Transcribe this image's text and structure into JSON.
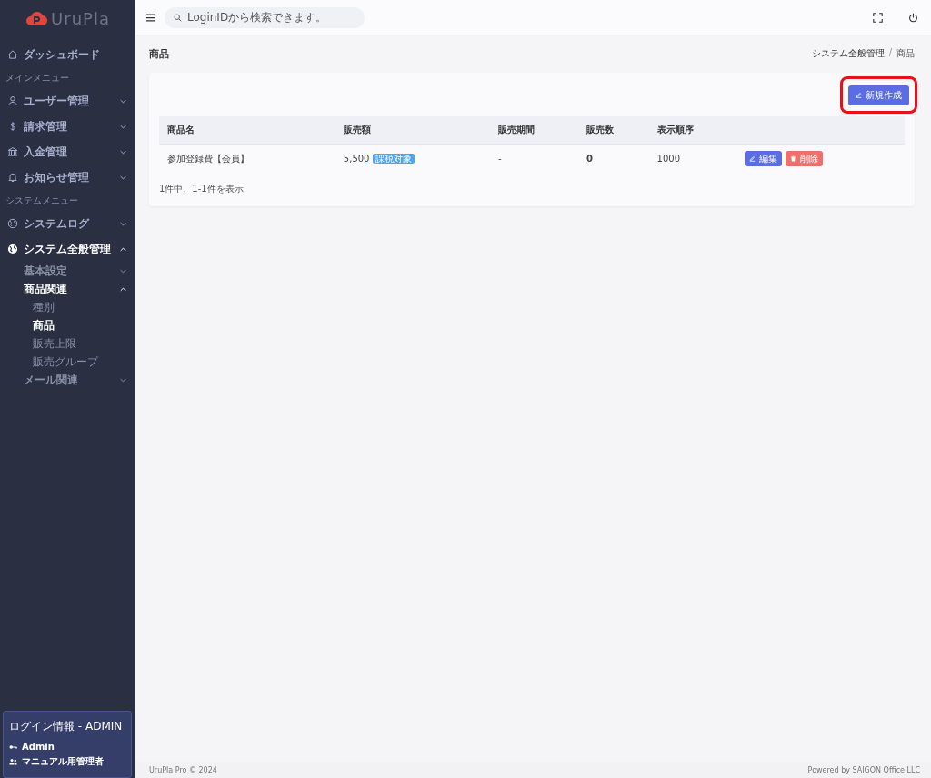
{
  "sidebar": {
    "logo": "UruPla",
    "items": [
      {
        "kind": "link",
        "label": "ダッシュボード"
      },
      {
        "kind": "heading",
        "label": "メインメニュー"
      },
      {
        "kind": "group",
        "label": "ユーザー管理",
        "expanded": false
      },
      {
        "kind": "group",
        "label": "請求管理",
        "expanded": false
      },
      {
        "kind": "group",
        "label": "入金管理",
        "expanded": false
      },
      {
        "kind": "group",
        "label": "お知らせ管理",
        "expanded": false
      },
      {
        "kind": "heading",
        "label": "システムメニュー"
      },
      {
        "kind": "group",
        "label": "システムログ",
        "expanded": false
      },
      {
        "kind": "group",
        "label": "システム全般管理",
        "expanded": true,
        "children": [
          {
            "label": "基本設定",
            "expanded": false
          },
          {
            "label": "商品関連",
            "expanded": true,
            "children": [
              {
                "label": "種別",
                "selected": false
              },
              {
                "label": "商品",
                "selected": true
              },
              {
                "label": "販売上限",
                "selected": false
              },
              {
                "label": "販売グループ",
                "selected": false
              }
            ]
          },
          {
            "label": "メール関連",
            "expanded": false
          }
        ]
      }
    ],
    "login": {
      "title": "ログイン情報 - ADMIN",
      "user": "Admin",
      "role": "マニュアル用管理者"
    }
  },
  "topbar": {
    "search": {
      "placeholder": "LoginIDから検索できます。"
    }
  },
  "page": {
    "title": "商品",
    "breadcrumb": [
      "システム全般管理",
      "商品"
    ],
    "breadcrumb_separator": "/"
  },
  "new_button": "新規作成",
  "table": {
    "columns": [
      "商品名",
      "販売額",
      "販売期間",
      "販売数",
      "表示順序"
    ],
    "rows": [
      {
        "name": "参加登録費【会員】",
        "price": "5,500",
        "tag": "課税対象",
        "period": "-",
        "sold": "0",
        "order": "1000",
        "edit": "編集",
        "delete": "削除"
      }
    ]
  },
  "summary": "1件中、1-1件を表示",
  "footer": {
    "left": "UruPla Pro © 2024",
    "right": "Powered by SAIGON Office LLC"
  }
}
